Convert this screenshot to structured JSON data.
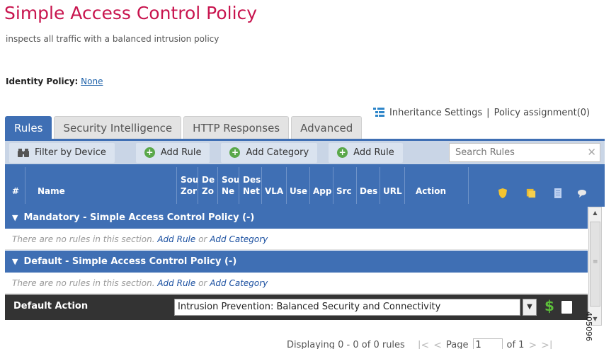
{
  "header": {
    "title": "Simple Access Control Policy",
    "subtitle": "inspects all traffic with a balanced intrusion policy",
    "identity_label": "Identity Policy:",
    "identity_value": "None"
  },
  "links": {
    "inheritance": "Inheritance Settings",
    "separator": "|",
    "assignment": "Policy assignment(0)"
  },
  "tabs": [
    {
      "label": "Rules",
      "active": true
    },
    {
      "label": "Security Intelligence",
      "active": false
    },
    {
      "label": "HTTP Responses",
      "active": false
    },
    {
      "label": "Advanced",
      "active": false
    }
  ],
  "toolbar": {
    "filter_label": "Filter by Device",
    "add_rule_label": "Add Rule",
    "add_category_label": "Add Category",
    "add_rule2_label": "Add Rule",
    "search_placeholder": "Search Rules"
  },
  "table": {
    "columns": {
      "num": "#",
      "name": "Name",
      "src_zones": "Sou Zor",
      "dst_zones": "De Zo",
      "src_net": "Sou Ne",
      "dst_net": "Des Net",
      "vlan": "VLA",
      "users": "Use",
      "apps": "App",
      "src_ports": "Src",
      "dst_ports": "Des",
      "urls": "URL",
      "action": "Action"
    },
    "header_icons": [
      "shield-icon",
      "folder-icon",
      "document-icon",
      "comment-icon"
    ],
    "sections": [
      {
        "title": "Mandatory - Simple Access Control Policy (-)",
        "empty_text": "There are no rules in this section.",
        "add_rule": "Add Rule",
        "or": "or",
        "add_category": "Add Category"
      },
      {
        "title": "Default - Simple Access Control Policy (-)",
        "empty_text": "There are no rules in this section.",
        "add_rule": "Add Rule",
        "or": "or",
        "add_category": "Add Category"
      }
    ],
    "default_action": {
      "label": "Default Action",
      "value": "Intrusion Prevention: Balanced Security and Connectivity"
    }
  },
  "pager": {
    "summary": "Displaying 0 - 0 of 0 rules",
    "page_label": "Page",
    "page_value": "1",
    "of_label": "of 1"
  },
  "figure_id": "405096",
  "colors": {
    "title": "#c8144e",
    "accent": "#3f6fb4",
    "add_icon": "#5aa84a",
    "default_row": "#333333"
  }
}
